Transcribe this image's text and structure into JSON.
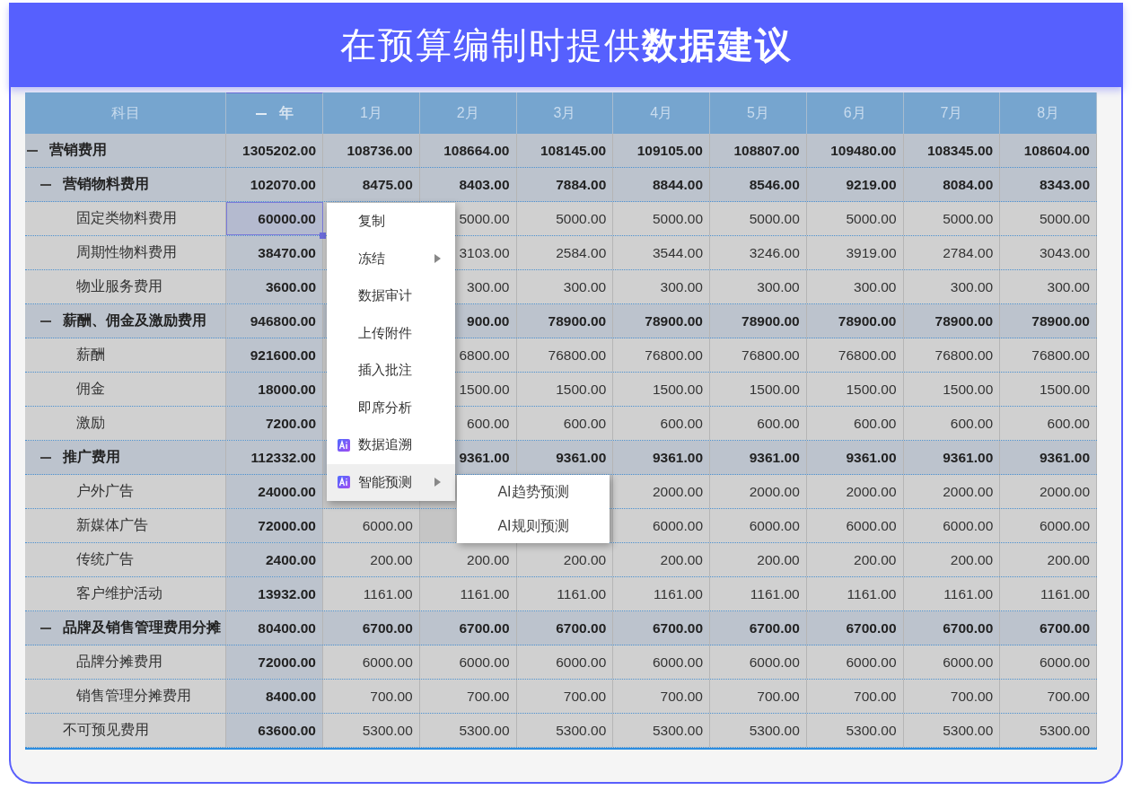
{
  "banner": {
    "title": "在预算编制时提供**数据建议**"
  },
  "table": {
    "columns": [
      {
        "label": "科目",
        "kind": "subject"
      },
      {
        "label": "年",
        "kind": "year",
        "expanded": true
      },
      {
        "label": "1月",
        "kind": "month"
      },
      {
        "label": "2月",
        "kind": "month"
      },
      {
        "label": "3月",
        "kind": "month"
      },
      {
        "label": "4月",
        "kind": "month"
      },
      {
        "label": "5月",
        "kind": "month"
      },
      {
        "label": "6月",
        "kind": "month"
      },
      {
        "label": "7月",
        "kind": "month"
      },
      {
        "label": "8月",
        "kind": "month"
      }
    ],
    "rows": [
      {
        "label": "营销费用",
        "expanded": true,
        "selected": false,
        "values": [
          "1305202.00",
          "108736.00",
          "108664.00",
          "108145.00",
          "109105.00",
          "108807.00",
          "109480.00",
          "108345.00",
          "108604.00"
        ],
        "children": [
          {
            "label": "营销物料费用",
            "expanded": true,
            "selected": false,
            "values": [
              "102070.00",
              "8475.00",
              "8403.00",
              "7884.00",
              "8844.00",
              "8546.00",
              "9219.00",
              "8084.00",
              "8343.00"
            ],
            "children": [
              {
                "label": "固定类物料费用",
                "selected": true,
                "values": [
                  "60000.00",
                  {
                    "kind": "covered"
                  },
                  "5000.00",
                  "5000.00",
                  "5000.00",
                  "5000.00",
                  "5000.00",
                  "5000.00",
                  "5000.00"
                ]
              },
              {
                "label": "周期性物料费用",
                "selected": false,
                "values": [
                  "38470.00",
                  {
                    "kind": "covered"
                  },
                  "3103.00",
                  "2584.00",
                  "3544.00",
                  "3246.00",
                  "3919.00",
                  "2784.00",
                  "3043.00"
                ]
              },
              {
                "label": "物业服务费用",
                "selected": false,
                "values": [
                  "3600.00",
                  {
                    "kind": "covered"
                  },
                  "300.00",
                  "300.00",
                  "300.00",
                  "300.00",
                  "300.00",
                  "300.00",
                  "300.00"
                ]
              }
            ]
          },
          {
            "label": "薪酬、佣金及激励费用",
            "expanded": true,
            "selected": false,
            "values": [
              "946800.00",
              {
                "kind": "covered"
              },
              "900.00",
              "78900.00",
              "78900.00",
              "78900.00",
              "78900.00",
              "78900.00",
              "78900.00"
            ],
            "children": [
              {
                "label": "薪酬",
                "selected": false,
                "values": [
                  "921600.00",
                  {
                    "kind": "covered"
                  },
                  "6800.00",
                  "76800.00",
                  "76800.00",
                  "76800.00",
                  "76800.00",
                  "76800.00",
                  "76800.00"
                ]
              },
              {
                "label": "佣金",
                "selected": false,
                "values": [
                  "18000.00",
                  {
                    "kind": "covered"
                  },
                  "1500.00",
                  "1500.00",
                  "1500.00",
                  "1500.00",
                  "1500.00",
                  "1500.00",
                  "1500.00"
                ]
              },
              {
                "label": "激励",
                "selected": false,
                "values": [
                  "7200.00",
                  {
                    "kind": "covered"
                  },
                  "600.00",
                  "600.00",
                  "600.00",
                  "600.00",
                  "600.00",
                  "600.00",
                  "600.00"
                ]
              }
            ]
          },
          {
            "label": "推广费用",
            "expanded": true,
            "selected": false,
            "values": [
              "112332.00",
              {
                "kind": "covered"
              },
              "9361.00",
              "9361.00",
              "9361.00",
              "9361.00",
              "9361.00",
              "9361.00",
              "9361.00"
            ],
            "children": [
              {
                "label": "户外广告",
                "selected": false,
                "values": [
                  "24000.00",
                  {
                    "kind": "covered"
                  },
                  {
                    "kind": "covered"
                  },
                  {
                    "kind": "covered"
                  },
                  "2000.00",
                  "2000.00",
                  "2000.00",
                  "2000.00",
                  "2000.00"
                ]
              },
              {
                "label": "新媒体广告",
                "selected": false,
                "values": [
                  "72000.00",
                  "6000.00",
                  {
                    "kind": "covered"
                  },
                  {
                    "kind": "covered"
                  },
                  "6000.00",
                  "6000.00",
                  "6000.00",
                  "6000.00",
                  "6000.00"
                ]
              },
              {
                "label": "传统广告",
                "selected": false,
                "values": [
                  "2400.00",
                  "200.00",
                  "200.00",
                  "200.00",
                  "200.00",
                  "200.00",
                  "200.00",
                  "200.00",
                  "200.00"
                ]
              },
              {
                "label": "客户维护活动",
                "selected": false,
                "values": [
                  "13932.00",
                  "1161.00",
                  "1161.00",
                  "1161.00",
                  "1161.00",
                  "1161.00",
                  "1161.00",
                  "1161.00",
                  "1161.00"
                ]
              }
            ]
          },
          {
            "label": "品牌及销售管理费用分摊",
            "expanded": true,
            "selected": false,
            "values": [
              "80400.00",
              "6700.00",
              "6700.00",
              "6700.00",
              "6700.00",
              "6700.00",
              "6700.00",
              "6700.00",
              "6700.00"
            ],
            "children": [
              {
                "label": "品牌分摊费用",
                "selected": false,
                "values": [
                  "72000.00",
                  "6000.00",
                  "6000.00",
                  "6000.00",
                  "6000.00",
                  "6000.00",
                  "6000.00",
                  "6000.00",
                  "6000.00"
                ]
              },
              {
                "label": "销售管理分摊费用",
                "selected": false,
                "values": [
                  "8400.00",
                  "700.00",
                  "700.00",
                  "700.00",
                  "700.00",
                  "700.00",
                  "700.00",
                  "700.00",
                  "700.00"
                ]
              }
            ]
          },
          {
            "label": "不可预见费用",
            "selected": false,
            "values": [
              "63600.00",
              "5300.00",
              "5300.00",
              "5300.00",
              "5300.00",
              "5300.00",
              "5300.00",
              "5300.00",
              "5300.00"
            ]
          }
        ]
      }
    ]
  },
  "context_menu": {
    "items": [
      {
        "label": "复制",
        "kind": "plain",
        "submenu": false,
        "selected": false
      },
      {
        "label": "冻结",
        "kind": "plain",
        "submenu": true,
        "selected": false
      },
      {
        "label": "数据审计",
        "kind": "plain",
        "submenu": false,
        "selected": false
      },
      {
        "label": "上传附件",
        "kind": "plain",
        "submenu": false,
        "selected": false
      },
      {
        "label": "插入批注",
        "kind": "plain",
        "submenu": false,
        "selected": false
      },
      {
        "label": "即席分析",
        "kind": "plain",
        "submenu": false,
        "selected": false
      },
      {
        "label": "数据追溯",
        "kind": "ai",
        "submenu": false,
        "selected": false
      },
      {
        "label": "智能预测",
        "kind": "ai",
        "submenu": true,
        "selected": true
      }
    ],
    "submenu": {
      "items": [
        {
          "label": "AI趋势预测"
        },
        {
          "label": "AI规则预测"
        }
      ]
    }
  }
}
